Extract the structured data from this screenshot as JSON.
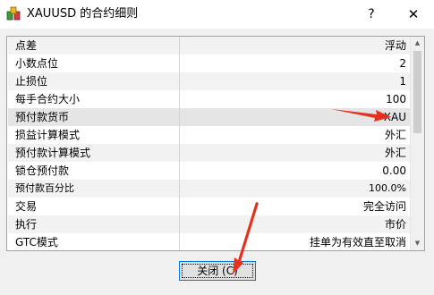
{
  "window": {
    "title": "XAUUSD 的合约细则",
    "help_label": "?",
    "close_label": "✕",
    "icon": "contract-spec-app-icon"
  },
  "spec_rows": [
    {
      "name": "点差",
      "value": "浮动"
    },
    {
      "name": "小数点位",
      "value": "2"
    },
    {
      "name": "止损位",
      "value": "1"
    },
    {
      "name": "每手合约大小",
      "value": "100"
    },
    {
      "name": "预付款货币",
      "value": "XAU"
    },
    {
      "name": "损益计算模式",
      "value": "外汇"
    },
    {
      "name": "预付款计算模式",
      "value": "外汇"
    },
    {
      "name": "锁仓预付款",
      "value": "0.00"
    },
    {
      "name": "预付款百分比",
      "value": "100.0%"
    },
    {
      "name": "交易",
      "value": "完全访问"
    },
    {
      "name": "执行",
      "value": "市价"
    },
    {
      "name": "GTC模式",
      "value": "挂单为有效直至取消"
    }
  ],
  "scrollbar": {
    "up_icon": "▲",
    "down_icon": "▼"
  },
  "footer": {
    "close_button_label": "关闭 (C)"
  },
  "colors": {
    "annotation_arrow": "#e8301e",
    "focus_border": "#0078d7"
  }
}
